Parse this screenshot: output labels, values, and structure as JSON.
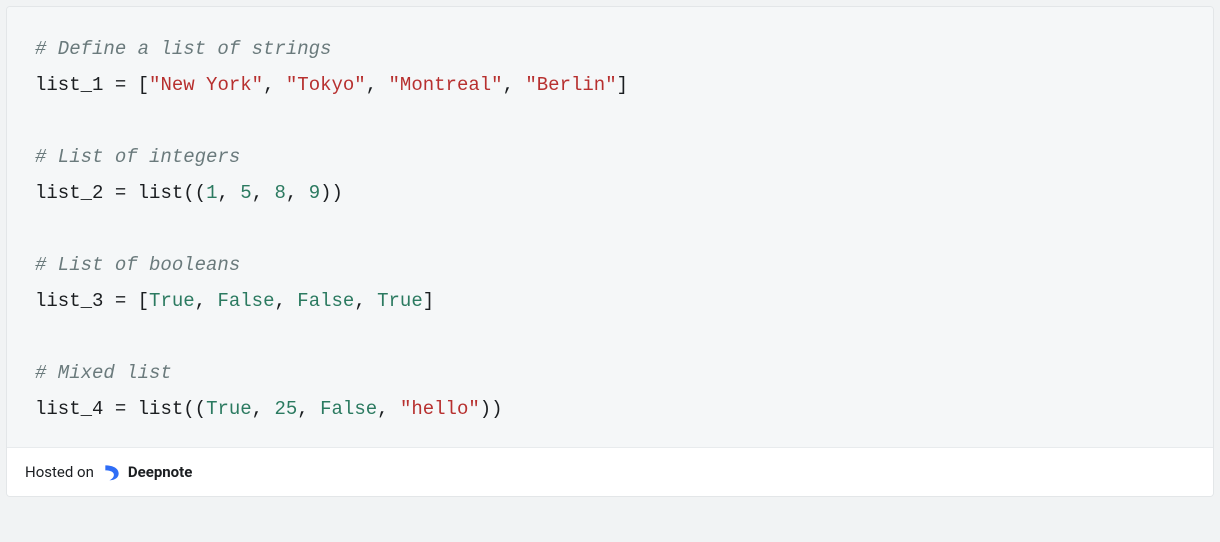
{
  "code": {
    "comment_strings": "# Define a list of strings",
    "l1_var": "list_1",
    "l1_vals": [
      "\"New York\"",
      "\"Tokyo\"",
      "\"Montreal\"",
      "\"Berlin\""
    ],
    "comment_ints": "# List of integers",
    "l2_var": "list_2",
    "l2_builtin": "list",
    "l2_vals": [
      "1",
      "5",
      "8",
      "9"
    ],
    "comment_bools": "# List of booleans",
    "l3_var": "list_3",
    "l3_vals": [
      "True",
      "False",
      "False",
      "True"
    ],
    "comment_mixed": "# Mixed list",
    "l4_var": "list_4",
    "l4_builtin": "list",
    "l4_vals_bool0": "True",
    "l4_vals_num1": "25",
    "l4_vals_bool2": "False",
    "l4_vals_str3": "\"hello\"",
    "eq": " = ",
    "comma": ", ",
    "lbrack": "[",
    "rbrack": "]",
    "lpar": "(",
    "rpar": ")",
    "dlpar": "((",
    "drpar": "))"
  },
  "footer": {
    "prefix": "Hosted on",
    "brand": "Deepnote",
    "logo_color": "#2f6df6"
  }
}
